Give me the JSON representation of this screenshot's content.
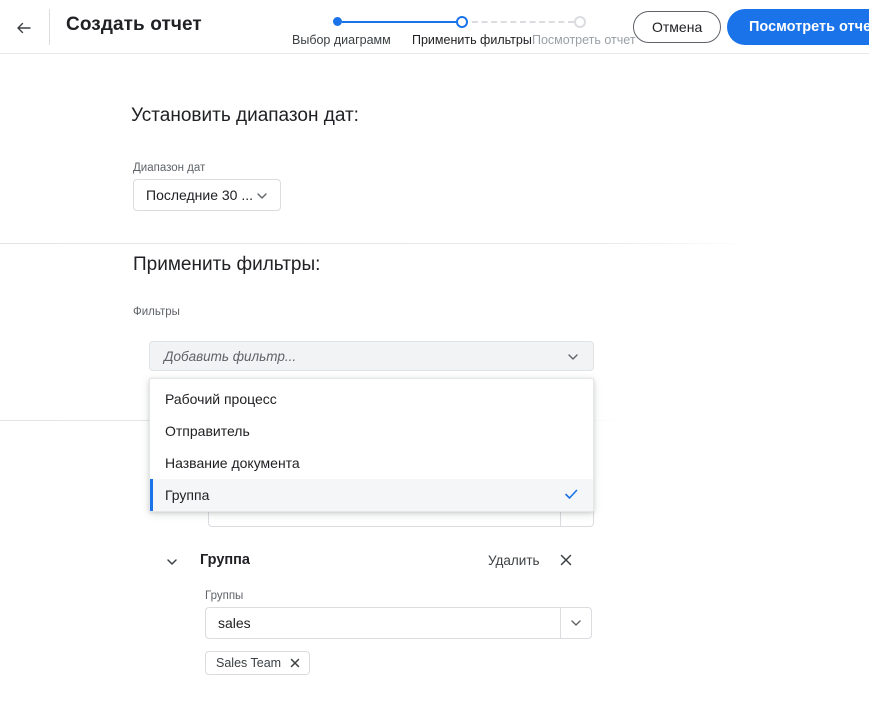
{
  "header": {
    "back_icon": "arrow-left-icon",
    "title": "Создать отчет",
    "cancel_label": "Отмена",
    "primary_label": "Посмотреть отчет"
  },
  "stepper": {
    "steps": [
      {
        "label": "Выбор диаграмм",
        "state": "completed"
      },
      {
        "label": "Применить фильтры",
        "state": "current"
      },
      {
        "label": "Посмотреть отчет",
        "state": "upcoming"
      }
    ],
    "accent_color": "#1a73e8",
    "inactive_color": "#dadce0"
  },
  "date_section": {
    "heading": "Установить диапазон дат:",
    "field_label": "Диапазон дат",
    "selected_value": "Последние 30 ...",
    "chevron_icon": "chevron-down-icon"
  },
  "filters_section": {
    "heading": "Применить фильтры:",
    "field_label": "Фильтры",
    "add_filter_placeholder": "Добавить фильтр...",
    "chevron_icon": "chevron-down-icon"
  },
  "dropdown": {
    "options": [
      {
        "label": "Рабочий процесс",
        "selected": false
      },
      {
        "label": "Отправитель",
        "selected": false
      },
      {
        "label": "Название документа",
        "selected": false
      },
      {
        "label": "Группа",
        "selected": true
      }
    ],
    "check_icon": "check-icon",
    "selected_accent": "#1a73e8"
  },
  "group_filter": {
    "collapse_icon": "chevron-down-icon",
    "title": "Группа",
    "remove_label": "Удалить",
    "close_icon": "close-icon",
    "groups_label": "Группы",
    "groups_value": "sales",
    "groups_chevron_icon": "chevron-down-icon",
    "chips": [
      {
        "label": "Sales Team",
        "remove_icon": "close-icon"
      }
    ]
  }
}
